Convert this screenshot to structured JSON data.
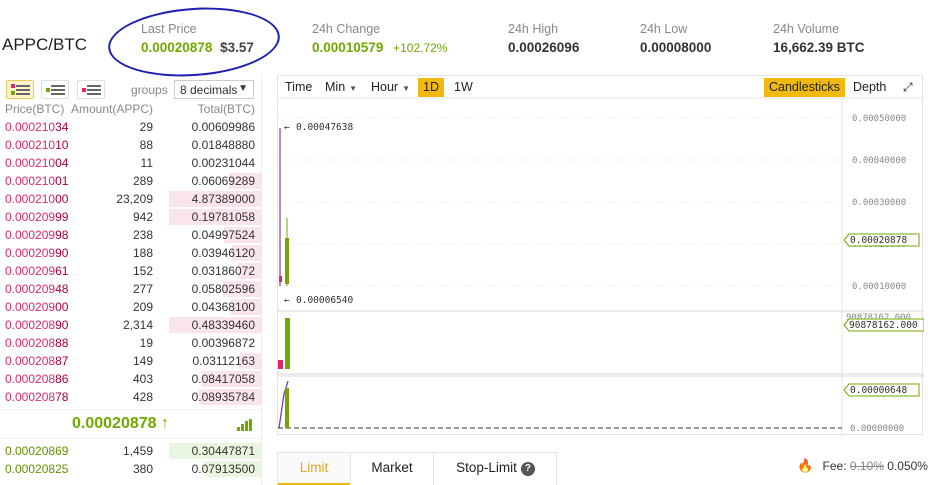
{
  "header": {
    "pair": "APPC/BTC",
    "last_price_label": "Last Price",
    "last_price": "0.00020878",
    "last_price_usd": "$3.57",
    "change_label": "24h Change",
    "change_value": "0.00010579",
    "change_pct": "+102.72%",
    "high_label": "24h High",
    "high_value": "0.00026096",
    "low_label": "24h Low",
    "low_value": "0.00008000",
    "volume_label": "24h Volume",
    "volume_value": "16,662.39 BTC"
  },
  "book": {
    "groups_label": "groups",
    "decimals": "8 decimals",
    "col_price": "Price(BTC)",
    "col_amount": "Amount(APPC)",
    "col_total": "Total(BTC)",
    "asks": [
      {
        "p1": "0.000210",
        "p2": "34",
        "amount": "29",
        "total": "0.00609986",
        "depth": 0.0
      },
      {
        "p1": "0.000210",
        "p2": "10",
        "amount": "88",
        "total": "0.01848880",
        "depth": 0.0
      },
      {
        "p1": "0.000210",
        "p2": "04",
        "amount": "11",
        "total": "0.00231044",
        "depth": 0.0
      },
      {
        "p1": "0.000210",
        "p2": "01",
        "amount": "289",
        "total": "0.06069289",
        "depth": 0.35
      },
      {
        "p1": "0.000210",
        "p2": "00",
        "amount": "23,209",
        "total": "4.87389000",
        "depth": 1.0
      },
      {
        "p1": "0.000209",
        "p2": "99",
        "amount": "942",
        "total": "0.19781058",
        "depth": 1.0
      },
      {
        "p1": "0.000209",
        "p2": "98",
        "amount": "238",
        "total": "0.04997524",
        "depth": 0.4
      },
      {
        "p1": "0.000209",
        "p2": "90",
        "amount": "188",
        "total": "0.03946120",
        "depth": 0.31
      },
      {
        "p1": "0.000209",
        "p2": "61",
        "amount": "152",
        "total": "0.03186072",
        "depth": 0.25
      },
      {
        "p1": "0.000209",
        "p2": "48",
        "amount": "277",
        "total": "0.05802596",
        "depth": 0.41
      },
      {
        "p1": "0.000209",
        "p2": "00",
        "amount": "209",
        "total": "0.04368100",
        "depth": 0.33
      },
      {
        "p1": "0.000208",
        "p2": "90",
        "amount": "2,314",
        "total": "0.48339460",
        "depth": 1.0
      },
      {
        "p1": "0.000208",
        "p2": "88",
        "amount": "19",
        "total": "0.00396872",
        "depth": 0.0
      },
      {
        "p1": "0.000208",
        "p2": "87",
        "amount": "149",
        "total": "0.03112163",
        "depth": 0.24
      },
      {
        "p1": "0.000208",
        "p2": "86",
        "amount": "403",
        "total": "0.08417058",
        "depth": 0.65
      },
      {
        "p1": "0.000208",
        "p2": "78",
        "amount": "428",
        "total": "0.08935784",
        "depth": 0.67
      }
    ],
    "last_price": "0.00020878",
    "last_arrow": "↑",
    "bids": [
      {
        "p1": "0.000208",
        "p2": "69",
        "amount": "1,459",
        "total": "0.30447871",
        "depth": 1.0
      },
      {
        "p1": "0.000208",
        "p2": "25",
        "amount": "380",
        "total": "0.07913500",
        "depth": 0.62
      }
    ]
  },
  "chart": {
    "tools": {
      "time": "Time",
      "min": "Min",
      "hour": "Hour",
      "d1": "1D",
      "w1": "1W",
      "candlesticks": "Candlesticks",
      "depth": "Depth"
    },
    "y_labels": [
      "0.00050000",
      "0.00040000",
      "0.00030000",
      "0.00020000",
      "0.00010000"
    ],
    "last_tag": "0.00020878",
    "high_annot": "0.00047638",
    "low_annot": "0.00006540",
    "vol_axis_top": "90878162.000",
    "vol_tag": "90878162.000",
    "ind_tag": "0.00000648",
    "ind_axis_bottom": "0.00000000",
    "colors": {
      "up": "#70a800",
      "down": "#e0266a",
      "accent": "#f0b90b"
    }
  },
  "trade": {
    "tab_limit": "Limit",
    "tab_market": "Market",
    "tab_stop": "Stop-Limit",
    "help": "?",
    "fee_label": "Fee:",
    "fee_old": "0.10%",
    "fee_new": "0.050%"
  }
}
